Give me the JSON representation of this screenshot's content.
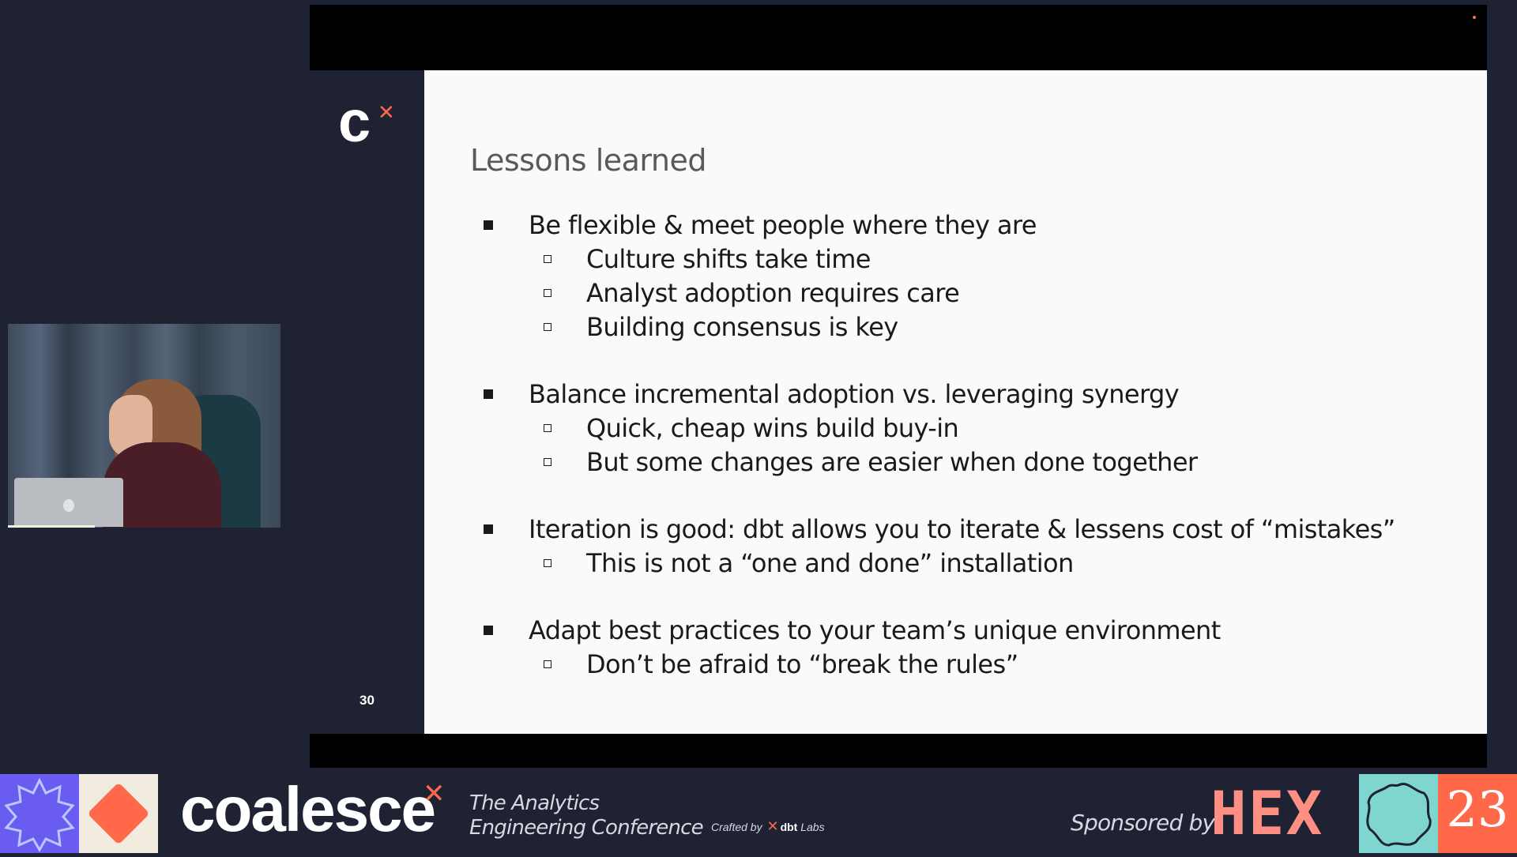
{
  "slide": {
    "title": "Lessons learned",
    "number": "30",
    "logo_letter": "c",
    "groups": [
      {
        "bullet": "Be flexible & meet people where they are",
        "subs": [
          "Culture shifts take time",
          "Analyst adoption requires care",
          "Building consensus is key"
        ]
      },
      {
        "bullet": "Balance incremental adoption vs. leveraging synergy",
        "subs": [
          "Quick, cheap wins build buy-in",
          "But some changes are easier when done together"
        ]
      },
      {
        "bullet": "Iteration is good: dbt allows you to iterate & lessens cost of “mistakes”",
        "subs": [
          "This is not a “one and done” installation"
        ]
      },
      {
        "bullet": "Adapt best practices to your team’s unique environment",
        "subs": [
          "Don’t be afraid to “break the rules”"
        ]
      }
    ]
  },
  "banner": {
    "brand": "coalesce",
    "tagline_line1": "The Analytics",
    "tagline_line2": "Engineering Conference",
    "crafted_by": "Crafted by",
    "crafted_brand": "dbt",
    "crafted_suffix": "Labs",
    "sponsored_by": "Sponsored by",
    "sponsor": "HEX",
    "year": "23"
  },
  "colors": {
    "background": "#1f2233",
    "accent": "#ff694a",
    "slide_bg": "#fafafa",
    "purple_badge": "#6a5cf0",
    "teal_badge": "#7fd6d0",
    "hex_pink": "#ff8f83"
  }
}
